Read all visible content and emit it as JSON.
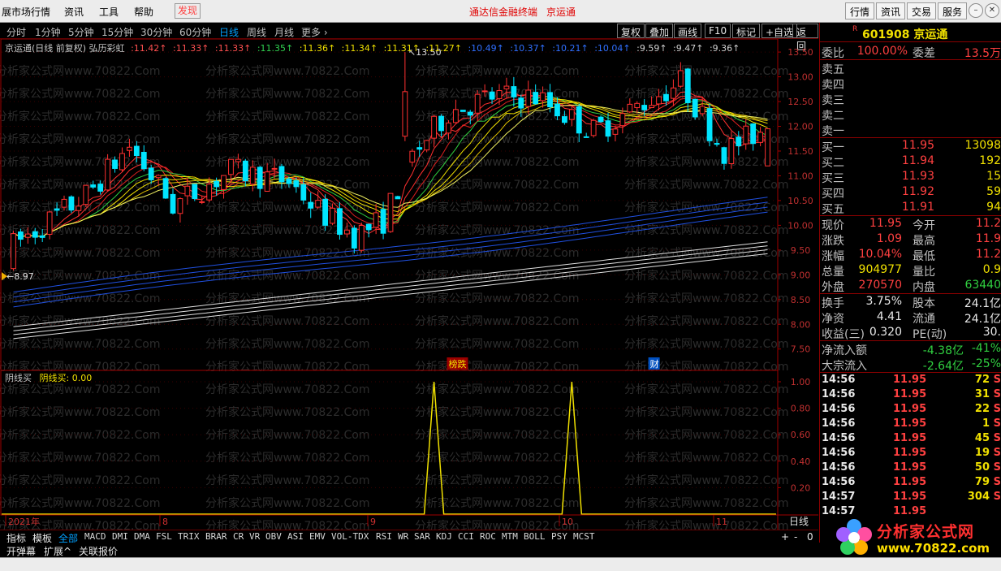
{
  "menu": {
    "items": [
      "展市场行情",
      "资讯",
      "工具",
      "帮助",
      "发现"
    ],
    "center_links": [
      "通达信金融终端",
      "京运通"
    ],
    "right_buttons": [
      "行情",
      "资讯",
      "交易",
      "服务"
    ]
  },
  "periods": {
    "items": [
      "分时",
      "1分钟",
      "5分钟",
      "15分钟",
      "30分钟",
      "60分钟",
      "日线",
      "周线",
      "月线",
      "更多 ›"
    ],
    "active": "日线",
    "tools": [
      "复权",
      "叠加",
      "画线",
      "F10",
      "标记",
      "+自选",
      "返回"
    ]
  },
  "chart_header": {
    "title": "京运通(日线 前复权) 弘历彩虹",
    "ma_values": [
      {
        "v": "11.42",
        "c": "r"
      },
      {
        "v": "11.33",
        "c": "r"
      },
      {
        "v": "11.33",
        "c": "r"
      },
      {
        "v": "11.35",
        "c": "g"
      },
      {
        "v": "11.36",
        "c": "y"
      },
      {
        "v": "11.34",
        "c": "y"
      },
      {
        "v": "11.31",
        "c": "y"
      },
      {
        "v": "11.27",
        "c": "y"
      },
      {
        "v": "10.49",
        "c": "b"
      },
      {
        "v": "10.37",
        "c": "b"
      },
      {
        "v": "10.21",
        "c": "b"
      },
      {
        "v": "10.04",
        "c": "b"
      },
      {
        "v": "9.59",
        "c": "w"
      },
      {
        "v": "9.47",
        "c": "w"
      },
      {
        "v": "9.36",
        "c": "w"
      }
    ]
  },
  "price_axis": {
    "ticks": [
      "13.50",
      "13.00",
      "12.50",
      "12.00",
      "11.50",
      "11.00",
      "10.50",
      "10.00",
      "9.50",
      "9.00",
      "8.50",
      "8.00",
      "7.50"
    ],
    "max_label": "13.50",
    "min_label": "8.97"
  },
  "markers": [
    "榜跌",
    "财"
  ],
  "indicator": {
    "name": "阴线买",
    "value_label": "阴线买: 0.00",
    "ticks": [
      "1.00",
      "0.80",
      "0.60",
      "0.40",
      "0.20"
    ]
  },
  "date_axis": {
    "labels": [
      "2021年",
      "8",
      "9",
      "10",
      "11"
    ],
    "period_label": "日线",
    "controls": [
      "+",
      "-",
      "0"
    ]
  },
  "watermark": "分析家公式网www.70822.Com",
  "stock": {
    "code": "601908",
    "name": "京运通",
    "tag": "R"
  },
  "quote": {
    "webi_label": "委比",
    "webi": "100.00%",
    "weicha_label": "委差",
    "weicha": "13.5万",
    "sells": [
      {
        "label": "卖五",
        "price": "",
        "vol": ""
      },
      {
        "label": "卖四",
        "price": "",
        "vol": ""
      },
      {
        "label": "卖三",
        "price": "",
        "vol": ""
      },
      {
        "label": "卖二",
        "price": "",
        "vol": ""
      },
      {
        "label": "卖一",
        "price": "",
        "vol": ""
      }
    ],
    "buys": [
      {
        "label": "买一",
        "price": "11.95",
        "vol": "13098"
      },
      {
        "label": "买二",
        "price": "11.94",
        "vol": "192"
      },
      {
        "label": "买三",
        "price": "11.93",
        "vol": "15"
      },
      {
        "label": "买四",
        "price": "11.92",
        "vol": "59"
      },
      {
        "label": "买五",
        "price": "11.91",
        "vol": "94"
      }
    ],
    "stats": [
      {
        "k": "现价",
        "v": "11.95",
        "vc": "red",
        "k2": "今开",
        "v2": "11.2",
        "v2c": "red"
      },
      {
        "k": "涨跌",
        "v": "1.09",
        "vc": "red",
        "k2": "最高",
        "v2": "11.9",
        "v2c": "red"
      },
      {
        "k": "涨幅",
        "v": "10.04%",
        "vc": "red",
        "k2": "最低",
        "v2": "11.2",
        "v2c": "red"
      },
      {
        "k": "总量",
        "v": "904977",
        "vc": "yel",
        "k2": "量比",
        "v2": "0.9",
        "v2c": "yel"
      },
      {
        "k": "外盘",
        "v": "270570",
        "vc": "red",
        "k2": "内盘",
        "v2": "63440",
        "v2c": "grn"
      },
      {
        "k": "换手",
        "v": "3.75%",
        "vc": "wht",
        "k2": "股本",
        "v2": "24.1亿",
        "v2c": "wht"
      },
      {
        "k": "净资",
        "v": "4.41",
        "vc": "wht",
        "k2": "流通",
        "v2": "24.1亿",
        "v2c": "wht"
      },
      {
        "k": "收益(三)",
        "v": "0.320",
        "vc": "wht",
        "k2": "PE(动)",
        "v2": "30.",
        "v2c": "wht"
      }
    ],
    "flows": [
      {
        "k": "净流入额",
        "v": "-4.38亿",
        "v2": "-41%"
      },
      {
        "k": "大宗流入",
        "v": "-2.64亿",
        "v2": "-25%"
      }
    ]
  },
  "ticks": [
    {
      "t": "14:56",
      "p": "11.95",
      "q": "72",
      "a": "S"
    },
    {
      "t": "14:56",
      "p": "11.95",
      "q": "31",
      "a": "S"
    },
    {
      "t": "14:56",
      "p": "11.95",
      "q": "22",
      "a": "S"
    },
    {
      "t": "14:56",
      "p": "11.95",
      "q": "1",
      "a": "S"
    },
    {
      "t": "14:56",
      "p": "11.95",
      "q": "45",
      "a": "S"
    },
    {
      "t": "14:56",
      "p": "11.95",
      "q": "19",
      "a": "S"
    },
    {
      "t": "14:56",
      "p": "11.95",
      "q": "50",
      "a": "S"
    },
    {
      "t": "14:56",
      "p": "11.95",
      "q": "79",
      "a": "S"
    },
    {
      "t": "14:57",
      "p": "11.95",
      "q": "304",
      "a": "S"
    },
    {
      "t": "14:57",
      "p": "11.95",
      "q": "",
      "a": ""
    }
  ],
  "indicator_tabs": {
    "left": [
      "指标",
      "模板",
      "全部"
    ],
    "active": "全部",
    "items": [
      "MACD",
      "DMI",
      "DMA",
      "FSL",
      "TRIX",
      "BRAR",
      "CR",
      "VR",
      "OBV",
      "ASI",
      "EMV",
      "VOL-TDX",
      "RSI",
      "WR",
      "SAR",
      "KDJ",
      "CCI",
      "ROC",
      "MTM",
      "BOLL",
      "PSY",
      "MCST"
    ]
  },
  "bottom_buttons": [
    "开弹幕",
    "扩展^",
    "关联报价"
  ],
  "logo": {
    "name": "分析家公式网",
    "url": "www.70822.com"
  },
  "colors": {
    "up": "#ff3030",
    "down": "#00e5ff",
    "axis": "#a00000",
    "yellow": "#f0e000"
  }
}
